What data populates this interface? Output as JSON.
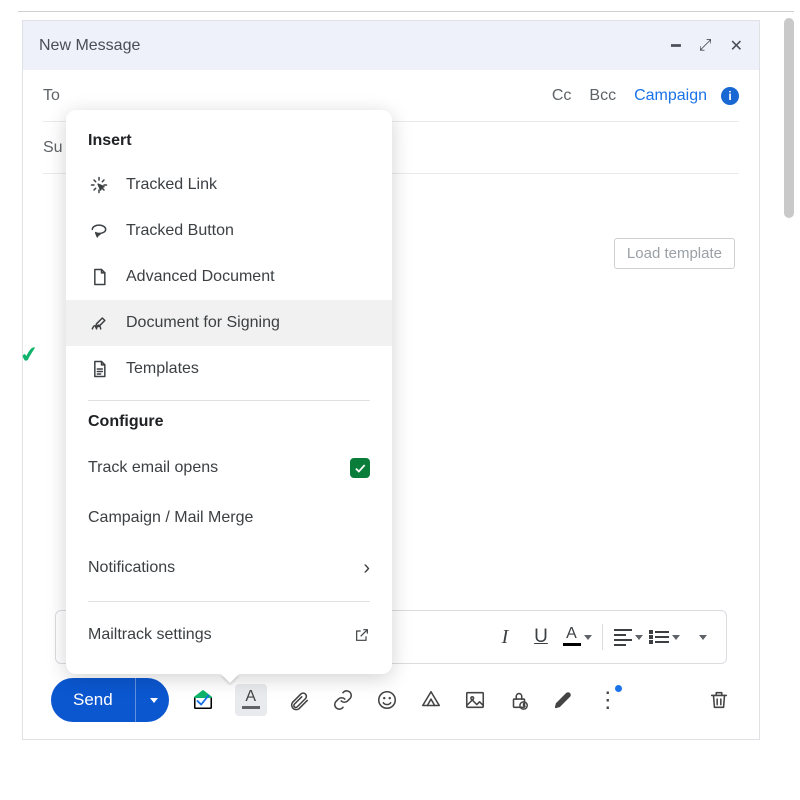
{
  "window": {
    "title": "New Message"
  },
  "header": {
    "to_label": "To",
    "subject_label_short": "Su",
    "cc": "Cc",
    "bcc": "Bcc",
    "campaign": "Campaign"
  },
  "actions": {
    "load_template": "Load template",
    "send": "Send"
  },
  "popover": {
    "insert_title": "Insert",
    "configure_title": "Configure",
    "items": {
      "tracked_link": "Tracked Link",
      "tracked_button": "Tracked Button",
      "advanced_document": "Advanced Document",
      "document_for_signing": "Document for Signing",
      "templates": "Templates"
    },
    "configure": {
      "track_email_opens": "Track email opens",
      "campaign_mail_merge": "Campaign / Mail Merge",
      "notifications": "Notifications",
      "mailtrack_settings": "Mailtrack settings"
    }
  },
  "toolbar": {
    "italic_glyph": "I",
    "underline_glyph": "U",
    "text_color_glyph": "A"
  }
}
